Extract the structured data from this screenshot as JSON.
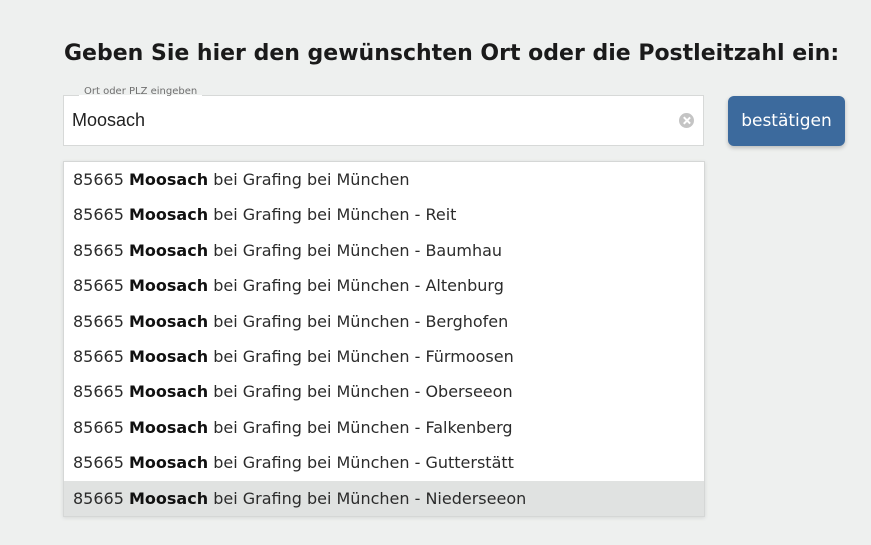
{
  "heading": "Geben Sie hier den gewünschten Ort oder die Postleitzahl ein:",
  "search": {
    "legend": "Ort oder PLZ eingeben",
    "value": "Moosach"
  },
  "confirm_label": "bestätigen",
  "suggestions": [
    {
      "plz": "85665",
      "match": "Moosach",
      "rest": " bei Grafing bei München",
      "active": false
    },
    {
      "plz": "85665",
      "match": "Moosach",
      "rest": " bei Grafing bei München - Reit",
      "active": false
    },
    {
      "plz": "85665",
      "match": "Moosach",
      "rest": " bei Grafing bei München - Baumhau",
      "active": false
    },
    {
      "plz": "85665",
      "match": "Moosach",
      "rest": " bei Grafing bei München - Altenburg",
      "active": false
    },
    {
      "plz": "85665",
      "match": "Moosach",
      "rest": " bei Grafing bei München - Berghofen",
      "active": false
    },
    {
      "plz": "85665",
      "match": "Moosach",
      "rest": " bei Grafing bei München - Fürmoosen",
      "active": false
    },
    {
      "plz": "85665",
      "match": "Moosach",
      "rest": " bei Grafing bei München - Oberseeon",
      "active": false
    },
    {
      "plz": "85665",
      "match": "Moosach",
      "rest": " bei Grafing bei München - Falkenberg",
      "active": false
    },
    {
      "plz": "85665",
      "match": "Moosach",
      "rest": " bei Grafing bei München - Gutterstätt",
      "active": false
    },
    {
      "plz": "85665",
      "match": "Moosach",
      "rest": " bei Grafing bei München - Niederseeon",
      "active": true
    }
  ],
  "colors": {
    "background": "#eef0ef",
    "button": "#3c6a9d",
    "active_row": "#e0e2e1"
  },
  "icons": {
    "clear": "clear-icon"
  }
}
